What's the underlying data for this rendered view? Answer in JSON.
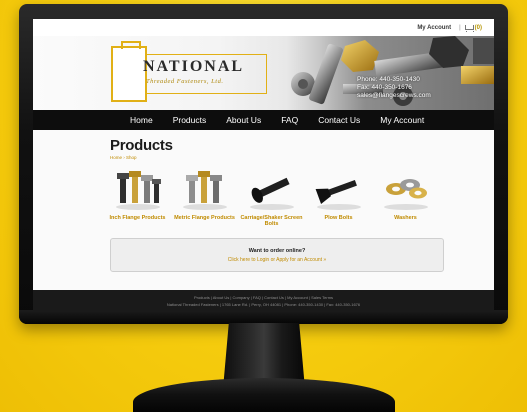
{
  "topbar": {
    "account_label": "My Account",
    "separator": "|",
    "cart_count": "(0)"
  },
  "header": {
    "logo_name": "NATIONAL",
    "logo_sub": "Threaded Fasteners, Ltd.",
    "phone": "Phone: 440-350-1430",
    "fax": "Fax: 440-350-1676",
    "email": "sales@flangescrews.com"
  },
  "nav": {
    "items": [
      {
        "label": "Home"
      },
      {
        "label": "Products"
      },
      {
        "label": "About Us"
      },
      {
        "label": "FAQ"
      },
      {
        "label": "Contact Us"
      },
      {
        "label": "My Account"
      }
    ]
  },
  "main": {
    "title": "Products",
    "breadcrumb": "Home › Shop",
    "categories": [
      {
        "label": "Inch Flange Products",
        "icon": "inch-flange-bolts-icon"
      },
      {
        "label": "Metric Flange Products",
        "icon": "metric-flange-bolts-icon"
      },
      {
        "label": "Carriage/Shaker Screen Bolts",
        "icon": "carriage-bolts-icon"
      },
      {
        "label": "Plow Bolts",
        "icon": "plow-bolts-icon"
      },
      {
        "label": "Washers",
        "icon": "washers-icon"
      }
    ],
    "order_prompt": "Want to order online?",
    "order_link": "Click here to Login or Apply for an Account »"
  },
  "footer": {
    "links": "Products | About Us | Company | FAQ | Contact Us | My Account | Sales Terms",
    "address": "National Threaded Fasteners  |  1765 Lane Rd.  |  Perry, OH 44081  |  Phone: 440-350-1430  |  Fax: 440-350-1676"
  },
  "colors": {
    "brand_gold": "#e1b016",
    "link_gold": "#c08b00",
    "nav_bg": "#0d0d0d",
    "background_yellow": "#f7cf10"
  }
}
